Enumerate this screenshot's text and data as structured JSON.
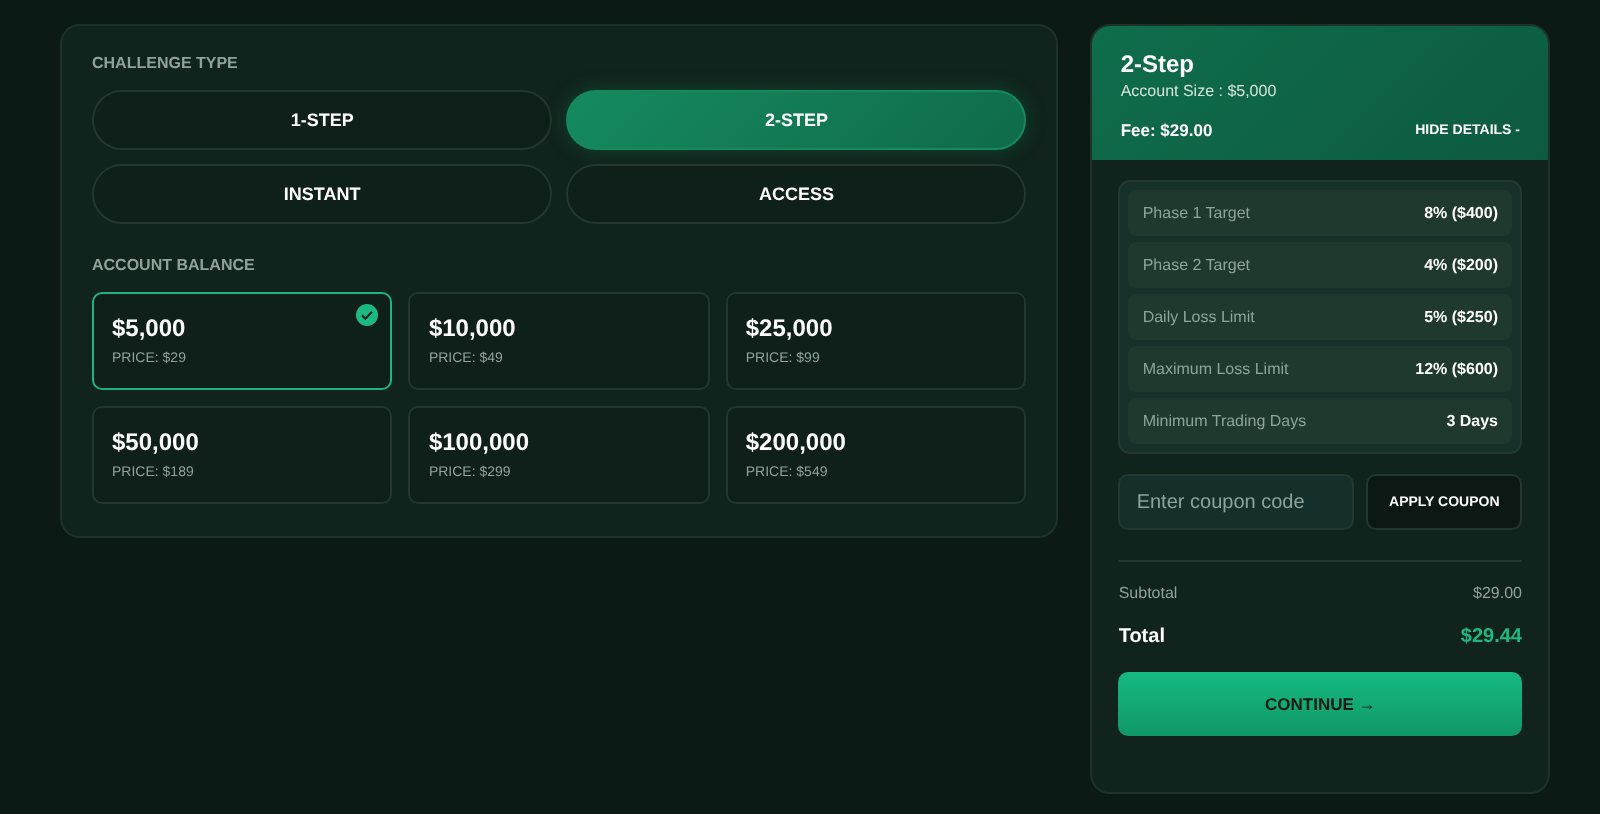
{
  "challenge_type": {
    "label": "CHALLENGE TYPE",
    "options": [
      {
        "label": "1-STEP",
        "selected": false
      },
      {
        "label": "2-STEP",
        "selected": true
      },
      {
        "label": "INSTANT",
        "selected": false
      },
      {
        "label": "ACCESS",
        "selected": false
      }
    ]
  },
  "account_balance": {
    "label": "ACCOUNT BALANCE",
    "options": [
      {
        "amount": "$5,000",
        "price": "PRICE: $29",
        "selected": true
      },
      {
        "amount": "$10,000",
        "price": "PRICE: $49",
        "selected": false
      },
      {
        "amount": "$25,000",
        "price": "PRICE: $99",
        "selected": false
      },
      {
        "amount": "$50,000",
        "price": "PRICE: $189",
        "selected": false
      },
      {
        "amount": "$100,000",
        "price": "PRICE: $299",
        "selected": false
      },
      {
        "amount": "$200,000",
        "price": "PRICE: $549",
        "selected": false
      }
    ]
  },
  "summary": {
    "title": "2-Step",
    "account_size": "Account Size : $5,000",
    "fee": "Fee: $29.00",
    "toggle": "HIDE DETAILS -",
    "details": [
      {
        "label": "Phase 1 Target",
        "value": "8% ($400)"
      },
      {
        "label": "Phase 2 Target",
        "value": "4% ($200)"
      },
      {
        "label": "Daily Loss Limit",
        "value": "5% ($250)"
      },
      {
        "label": "Maximum Loss Limit",
        "value": "12% ($600)"
      },
      {
        "label": "Minimum Trading Days",
        "value": "3 Days"
      }
    ],
    "coupon": {
      "placeholder": "Enter coupon code",
      "button": "APPLY COUPON"
    },
    "subtotal": {
      "label": "Subtotal",
      "value": "$29.00"
    },
    "total": {
      "label": "Total",
      "value": "$29.44"
    },
    "continue": "CONTINUE →"
  }
}
